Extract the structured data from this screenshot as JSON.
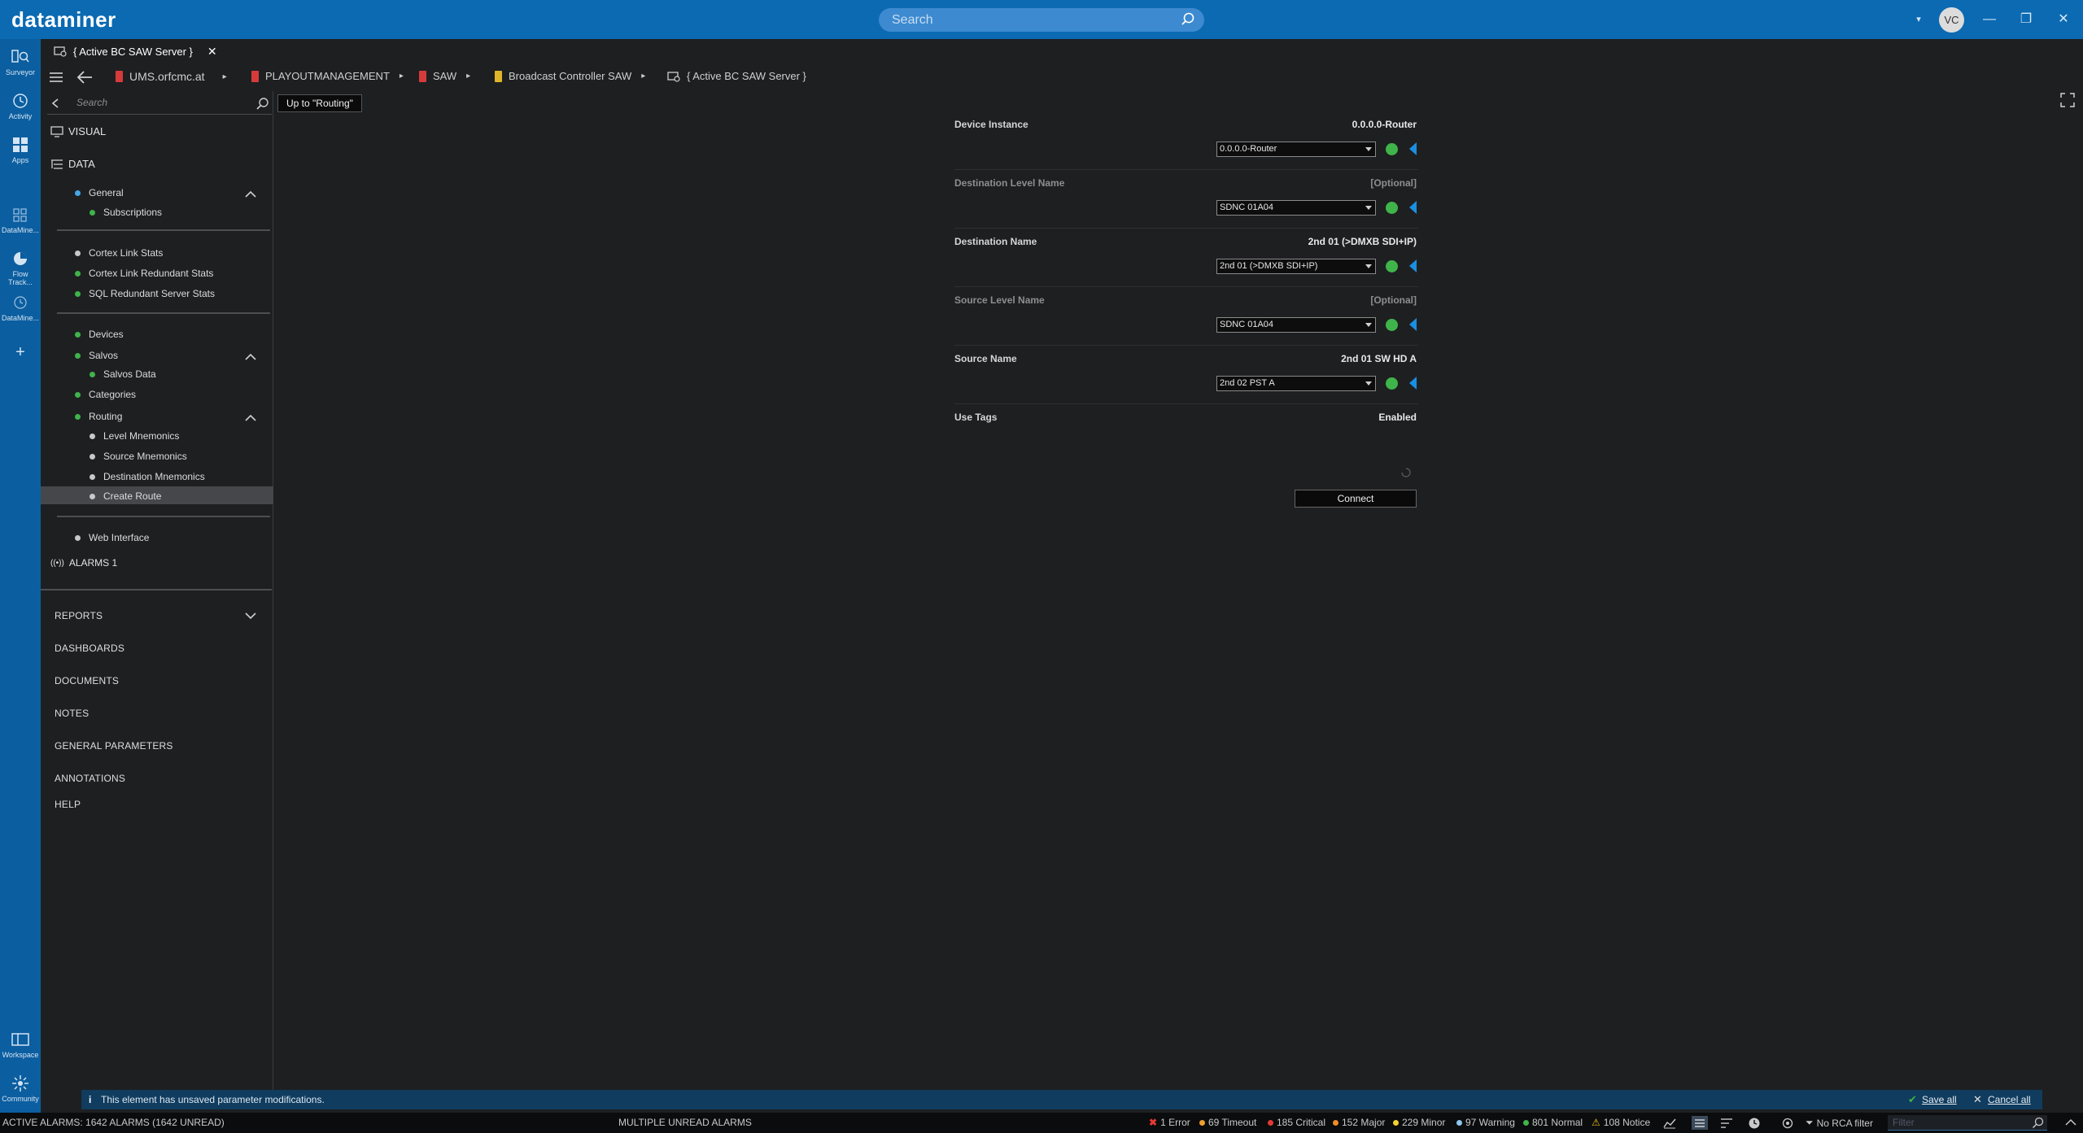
{
  "app": {
    "logo": "dataminer",
    "search_placeholder": "Search",
    "user_initials": "VC"
  },
  "rail": {
    "items": [
      {
        "label": "Surveyor"
      },
      {
        "label": "Activity"
      },
      {
        "label": "Apps"
      },
      {
        "label": "DataMine..."
      },
      {
        "label": "Flow Track..."
      },
      {
        "label": "DataMine..."
      }
    ],
    "workspace_label": "Workspace",
    "community_label": "Community"
  },
  "tab": {
    "title": "{ Active BC SAW Server }"
  },
  "breadcrumb": [
    {
      "label": "UMS.orfcmc.at"
    },
    {
      "label": "PLAYOUTMANAGEMENT"
    },
    {
      "label": "SAW"
    },
    {
      "label": "Broadcast Controller SAW"
    },
    {
      "label": "{ Active BC SAW Server }"
    }
  ],
  "sidebar": {
    "search_placeholder": "Search",
    "visual_label": "VISUAL",
    "data_label": "DATA",
    "tree": {
      "general": "General",
      "subscriptions": "Subscriptions",
      "cortex_link_stats": "Cortex Link Stats",
      "cortex_link_redundant_stats": "Cortex Link Redundant Stats",
      "sql_redundant_server_stats": "SQL Redundant Server Stats",
      "devices": "Devices",
      "salvos": "Salvos",
      "salvos_data": "Salvos Data",
      "categories": "Categories",
      "routing": "Routing",
      "level_mnemonics": "Level Mnemonics",
      "source_mnemonics": "Source Mnemonics",
      "destination_mnemonics": "Destination Mnemonics",
      "create_route": "Create Route",
      "web_interface": "Web Interface"
    },
    "alarms_label": "ALARMS 1",
    "menu": {
      "reports": "REPORTS",
      "dashboards": "DASHBOARDS",
      "documents": "DOCUMENTS",
      "notes": "NOTES",
      "general_parameters": "GENERAL PARAMETERS",
      "annotations": "ANNOTATIONS",
      "help": "HELP"
    }
  },
  "content": {
    "up_button": "Up to \"Routing\"",
    "rows": [
      {
        "label": "Device Instance",
        "value": "0.0.0.0-Router",
        "selected": "0.0.0.0-Router"
      },
      {
        "label": "Destination Level Name",
        "value": "[Optional]",
        "selected": "SDNC 01A04"
      },
      {
        "label": "Destination Name",
        "value": "2nd 01 (>DMXB SDI+IP)",
        "selected": "2nd 01 (>DMXB SDI+IP)"
      },
      {
        "label": "Source Level Name",
        "value": "[Optional]",
        "selected": "SDNC 01A04"
      },
      {
        "label": "Source Name",
        "value": "2nd 01 SW HD A",
        "selected": "2nd 02 PST A"
      }
    ],
    "use_tags_label": "Use Tags",
    "use_tags_value": "Enabled",
    "connect_button": "Connect"
  },
  "notice": {
    "message": "This element has unsaved parameter modifications.",
    "save_all": "Save all",
    "cancel_all": "Cancel all"
  },
  "status": {
    "active_alarms": "ACTIVE ALARMS: 1642 ALARMS (1642 UNREAD)",
    "multiple_unread": "MULTIPLE UNREAD ALARMS",
    "error": "1 Error",
    "timeout": "69 Timeout",
    "critical": "185 Critical",
    "major": "152 Major",
    "minor": "229 Minor",
    "warning": "97 Warning",
    "normal": "801 Normal",
    "notice": "108 Notice",
    "rca": "No RCA filter",
    "filter_placeholder": "Filter"
  },
  "colors": {
    "brand": "#0b6ab2",
    "ok": "#3fb44a",
    "critical": "#e53935",
    "timeout": "#f0a030",
    "major": "#f28c28",
    "minor": "#f2d22e",
    "warning": "#8fc6ee",
    "normal": "#3fb44a",
    "notice": "#f2c21b"
  }
}
